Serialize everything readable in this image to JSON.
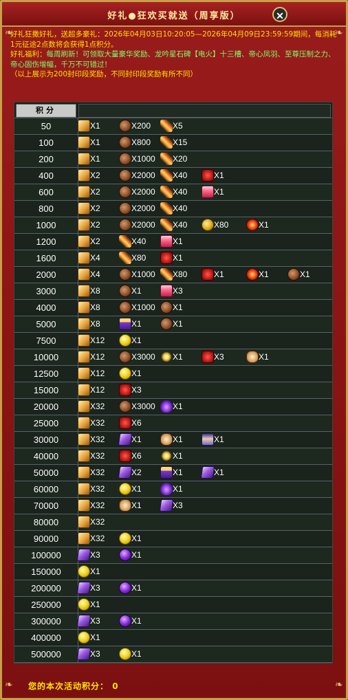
{
  "window": {
    "title": "好礼●狂欢买就送（周享版）",
    "close_label": "✕"
  },
  "notice": {
    "line1": "好礼狂撒好礼，送超多豪礼：2026年04月03日10:20:05—2026年04月09日23:59:59期间，每消耗1元征途2点数将会获得1点积分。",
    "line2_prefix": "好礼福利：",
    "line2": "每周刷新！可领取大量豪华奖励、龙吟星石碑【电火】十三槽、帝心凤羽、至尊压制之力、帝心固伤增幅，千万不可错过！",
    "line3": "（以上展示为200封印段奖励，不同封印段奖励有所不同）"
  },
  "table": {
    "header": "积分",
    "rows": [
      {
        "score": "50",
        "rewards": [
          {
            "icon": "scroll",
            "qty": "X1"
          },
          {
            "icon": "ore",
            "qty": "X200"
          },
          {
            "icon": "feather",
            "qty": "X5"
          }
        ]
      },
      {
        "score": "100",
        "rewards": [
          {
            "icon": "scroll",
            "qty": "X1"
          },
          {
            "icon": "ore",
            "qty": "X800"
          },
          {
            "icon": "feather",
            "qty": "X15"
          }
        ]
      },
      {
        "score": "200",
        "rewards": [
          {
            "icon": "scroll",
            "qty": "X1"
          },
          {
            "icon": "ore",
            "qty": "X1000"
          },
          {
            "icon": "feather",
            "qty": "X20"
          }
        ]
      },
      {
        "score": "400",
        "rewards": [
          {
            "icon": "scroll",
            "qty": "X2"
          },
          {
            "icon": "ore",
            "qty": "X2000"
          },
          {
            "icon": "feather",
            "qty": "X40"
          },
          {
            "icon": "redgift",
            "qty": "X1"
          }
        ]
      },
      {
        "score": "600",
        "rewards": [
          {
            "icon": "scroll",
            "qty": "X2"
          },
          {
            "icon": "ore",
            "qty": "X2000"
          },
          {
            "icon": "feather",
            "qty": "X40"
          },
          {
            "icon": "giftbox",
            "qty": "X1"
          }
        ]
      },
      {
        "score": "800",
        "rewards": [
          {
            "icon": "scroll",
            "qty": "X2"
          },
          {
            "icon": "ore",
            "qty": "X2000"
          },
          {
            "icon": "feather",
            "qty": "X40"
          }
        ]
      },
      {
        "score": "1000",
        "rewards": [
          {
            "icon": "scroll",
            "qty": "X2"
          },
          {
            "icon": "ore",
            "qty": "X2000"
          },
          {
            "icon": "feather",
            "qty": "X40"
          },
          {
            "icon": "goldore",
            "qty": "X80"
          },
          {
            "icon": "redwheel",
            "qty": "X1"
          }
        ]
      },
      {
        "score": "1200",
        "rewards": [
          {
            "icon": "scroll",
            "qty": "X2"
          },
          {
            "icon": "feather",
            "qty": "X40"
          },
          {
            "icon": "giftbox",
            "qty": "X1"
          }
        ]
      },
      {
        "score": "1600",
        "rewards": [
          {
            "icon": "scroll",
            "qty": "X4"
          },
          {
            "icon": "feather",
            "qty": "X80"
          },
          {
            "icon": "redgift",
            "qty": "X1"
          }
        ]
      },
      {
        "score": "2000",
        "rewards": [
          {
            "icon": "scroll",
            "qty": "X4"
          },
          {
            "icon": "ore",
            "qty": "X1000"
          },
          {
            "icon": "feather",
            "qty": "X80"
          },
          {
            "icon": "redgift",
            "qty": "X1"
          },
          {
            "icon": "redwheel",
            "qty": "X1"
          },
          {
            "icon": "ore",
            "qty": "X1"
          }
        ]
      },
      {
        "score": "3000",
        "rewards": [
          {
            "icon": "scroll",
            "qty": "X8"
          },
          {
            "icon": "ore",
            "qty": "X1"
          },
          {
            "icon": "giftbox",
            "qty": "X3"
          }
        ]
      },
      {
        "score": "4000",
        "rewards": [
          {
            "icon": "scroll",
            "qty": "X8"
          },
          {
            "icon": "ore",
            "qty": "X1000"
          },
          {
            "icon": "ore",
            "qty": "X1"
          }
        ]
      },
      {
        "score": "5000",
        "rewards": [
          {
            "icon": "scroll",
            "qty": "X8"
          },
          {
            "icon": "purplegift",
            "qty": "X1"
          },
          {
            "icon": "ore",
            "qty": "X1"
          }
        ]
      },
      {
        "score": "7500",
        "rewards": [
          {
            "icon": "scroll",
            "qty": "X12"
          },
          {
            "icon": "gold",
            "qty": "X1"
          }
        ]
      },
      {
        "score": "10000",
        "rewards": [
          {
            "icon": "scroll",
            "qty": "X12"
          },
          {
            "icon": "ore",
            "qty": "X3000"
          },
          {
            "icon": "spark",
            "qty": "X1"
          },
          {
            "icon": "redgift",
            "qty": "X3"
          },
          {
            "icon": "tiger",
            "qty": "X1"
          }
        ]
      },
      {
        "score": "12500",
        "rewards": [
          {
            "icon": "scroll",
            "qty": "X12"
          },
          {
            "icon": "gold",
            "qty": "X1"
          }
        ]
      },
      {
        "score": "15000",
        "rewards": [
          {
            "icon": "scroll",
            "qty": "X12"
          },
          {
            "icon": "redgift",
            "qty": "X3"
          }
        ]
      },
      {
        "score": "20000",
        "rewards": [
          {
            "icon": "scroll",
            "qty": "X32"
          },
          {
            "icon": "ore",
            "qty": "X3000"
          },
          {
            "icon": "bat",
            "qty": "X1"
          }
        ]
      },
      {
        "score": "25000",
        "rewards": [
          {
            "icon": "scroll",
            "qty": "X32"
          },
          {
            "icon": "redgift",
            "qty": "X6"
          }
        ]
      },
      {
        "score": "30000",
        "rewards": [
          {
            "icon": "scroll",
            "qty": "X32"
          },
          {
            "icon": "purplecard",
            "qty": "X1"
          },
          {
            "icon": "tiger",
            "qty": "X1"
          },
          {
            "icon": "girl",
            "qty": "X1"
          }
        ]
      },
      {
        "score": "40000",
        "rewards": [
          {
            "icon": "scroll",
            "qty": "X32"
          },
          {
            "icon": "redgift",
            "qty": "X6"
          },
          {
            "icon": "spark",
            "qty": "X1"
          }
        ]
      },
      {
        "score": "50000",
        "rewards": [
          {
            "icon": "scroll",
            "qty": "X32"
          },
          {
            "icon": "purplecard",
            "qty": "X2"
          },
          {
            "icon": "purplegift",
            "qty": "X1"
          },
          {
            "icon": "purplecard",
            "qty": "X1"
          }
        ]
      },
      {
        "score": "60000",
        "rewards": [
          {
            "icon": "scroll",
            "qty": "X32"
          },
          {
            "icon": "gold",
            "qty": "X1"
          },
          {
            "icon": "bat",
            "qty": "X1"
          }
        ]
      },
      {
        "score": "70000",
        "rewards": [
          {
            "icon": "scroll",
            "qty": "X32"
          },
          {
            "icon": "tiger",
            "qty": "X1"
          },
          {
            "icon": "purplecard",
            "qty": "X3"
          }
        ]
      },
      {
        "score": "80000",
        "rewards": [
          {
            "icon": "scroll",
            "qty": "X32"
          }
        ]
      },
      {
        "score": "90000",
        "rewards": [
          {
            "icon": "scroll",
            "qty": "X32"
          },
          {
            "icon": "gold",
            "qty": "X1"
          }
        ]
      },
      {
        "score": "100000",
        "rewards": [
          {
            "icon": "purplecard",
            "qty": "X3"
          },
          {
            "icon": "purpleorb",
            "qty": "X1"
          }
        ]
      },
      {
        "score": "150000",
        "rewards": [
          {
            "icon": "gold",
            "qty": "X1"
          }
        ]
      },
      {
        "score": "200000",
        "rewards": [
          {
            "icon": "purplecard",
            "qty": "X3"
          },
          {
            "icon": "purpleorb",
            "qty": "X1"
          }
        ]
      },
      {
        "score": "250000",
        "rewards": [
          {
            "icon": "gold",
            "qty": "X1"
          }
        ]
      },
      {
        "score": "300000",
        "rewards": [
          {
            "icon": "purplecard",
            "qty": "X3"
          },
          {
            "icon": "purpleorb",
            "qty": "X1"
          }
        ]
      },
      {
        "score": "400000",
        "rewards": [
          {
            "icon": "gold",
            "qty": "X1"
          }
        ]
      },
      {
        "score": "500000",
        "rewards": [
          {
            "icon": "purplecard",
            "qty": "X3"
          },
          {
            "icon": "gold",
            "qty": "X1"
          }
        ]
      }
    ]
  },
  "footer": {
    "label": "您的本次活动积分：",
    "value": "0"
  }
}
